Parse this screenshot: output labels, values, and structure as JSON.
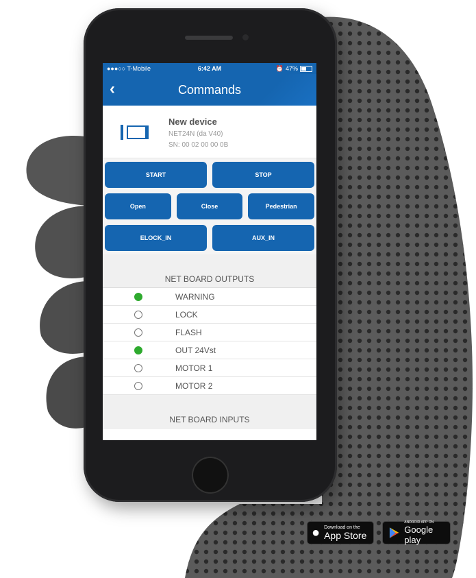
{
  "status_bar": {
    "carrier": "●●●○○ T-Mobile",
    "time": "6:42 AM",
    "battery": "47%",
    "battery_level": 0.47
  },
  "nav": {
    "back": "‹",
    "title": "Commands"
  },
  "device": {
    "name": "New device",
    "model": "NET24N (da V40)",
    "serial": "SN: 00 02 00 00 0B"
  },
  "buttons": {
    "row1": [
      "START",
      "STOP"
    ],
    "row2": [
      "Open",
      "Close",
      "Pedestrian"
    ],
    "row3": [
      "ELOCK_IN",
      "AUX_IN"
    ]
  },
  "outputs": {
    "title": "NET BOARD OUTPUTS",
    "items": [
      {
        "label": "WARNING",
        "on": true
      },
      {
        "label": "LOCK",
        "on": false
      },
      {
        "label": "FLASH",
        "on": false
      },
      {
        "label": "OUT 24Vst",
        "on": true
      },
      {
        "label": "MOTOR 1",
        "on": false
      },
      {
        "label": "MOTOR 2",
        "on": false
      }
    ]
  },
  "inputs": {
    "title": "NET BOARD INPUTS"
  },
  "stores": {
    "apple_small": "Download on the",
    "apple_big": "App Store",
    "google_small": "ANDROID APP ON",
    "google_big": "Google play"
  },
  "colors": {
    "primary": "#1565b0",
    "active_dot": "#2eaa2e"
  }
}
